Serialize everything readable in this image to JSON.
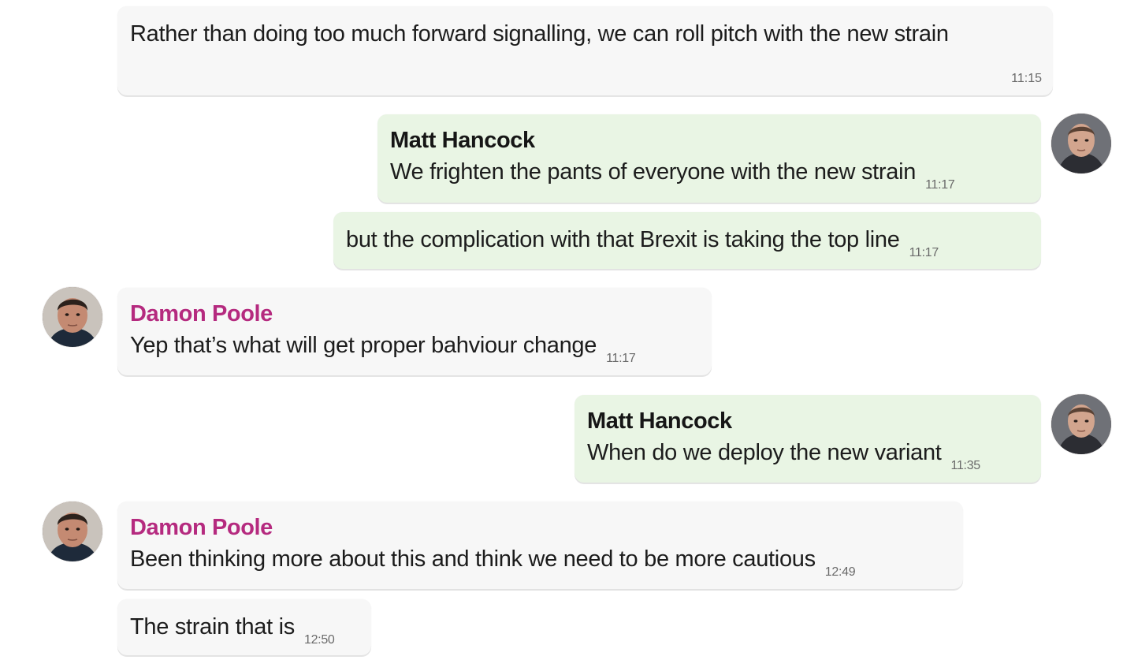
{
  "conversation": {
    "messages": [
      {
        "sender": "",
        "text": "Rather than doing too much forward signalling, we can roll pitch with the new strain",
        "time": "11:15",
        "direction": "incoming"
      },
      {
        "sender": "Matt Hancock",
        "text": "We frighten the pants of everyone with the new strain",
        "time": "11:17",
        "direction": "outgoing"
      },
      {
        "sender": "",
        "text": "but the complication with that Brexit is taking the top line",
        "time": "11:17",
        "direction": "outgoing"
      },
      {
        "sender": "Damon Poole",
        "text": "Yep that’s what will get proper bahviour change",
        "time": "11:17",
        "direction": "incoming"
      },
      {
        "sender": "Matt Hancock",
        "text": "When do we deploy the new variant",
        "time": "11:35",
        "direction": "outgoing"
      },
      {
        "sender": "Damon Poole",
        "text": "Been thinking more about this and think we need to be more cautious",
        "time": "12:49",
        "direction": "incoming"
      },
      {
        "sender": "",
        "text": "The strain that is",
        "time": "12:50",
        "direction": "incoming"
      }
    ]
  },
  "avatars": {
    "matt": "matt-hancock-avatar",
    "damon": "damon-poole-avatar"
  },
  "colors": {
    "incoming_bubble": "#f7f7f7",
    "outgoing_bubble": "#e9f5e4",
    "damon_name": "#b52a7f",
    "matt_name": "#161616",
    "timestamp": "#6a6a6a"
  }
}
